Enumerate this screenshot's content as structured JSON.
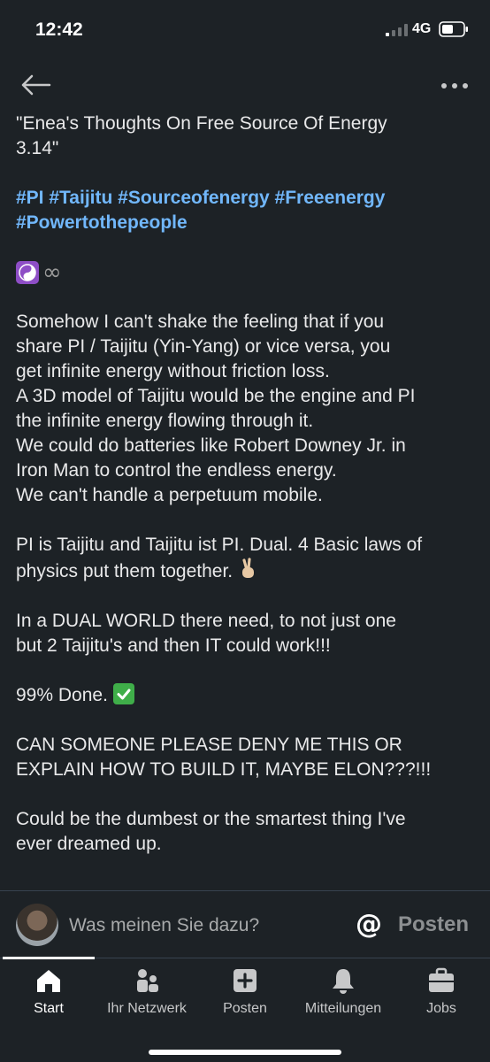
{
  "status_bar": {
    "time": "12:42",
    "network": "4G"
  },
  "nav": {
    "back_icon": "arrow-left-icon",
    "more_icon": "more-horizontal-icon"
  },
  "post": {
    "title_line1": "\"Enea's Thoughts On Free Source Of Energy",
    "title_line2": "3.14\"",
    "hashtags_line1": "#PI #Taijitu #Sourceofenergy #Freeenergy",
    "hashtags_line2": "#Powertothepeople",
    "emoji_icons": [
      "yin-yang-icon",
      "infinity-icon"
    ],
    "para1": [
      "Somehow I can't shake the feeling that if you",
      "share PI / Taijitu (Yin-Yang) or vice versa, you",
      "get infinite energy without friction loss.",
      "A 3D model of Taijitu would be the engine and PI",
      "the infinite energy flowing through it.",
      "We could do batteries like Robert Downey Jr. in",
      "Iron Man to control the endless energy.",
      "We can't handle a perpetuum mobile."
    ],
    "para2_line1": "PI is Taijitu and Taijitu ist PI. Dual. 4 Basic laws of",
    "para2_line2": "physics put them together.",
    "para3_line1": "In a DUAL WORLD there need, to not just one",
    "para3_line2": "but 2 Taijitu's and then IT could work!!!",
    "para4": "99% Done.",
    "para5_line1": "CAN SOMEONE PLEASE DENY ME THIS OR",
    "para5_line2": "EXPLAIN HOW TO BUILD IT, MAYBE ELON???!!!",
    "para6_line1": "Could be the dumbest or the smartest thing I've",
    "para6_line2": "ever dreamed up."
  },
  "comment_bar": {
    "placeholder": "Was meinen Sie dazu?",
    "mention_label": "@",
    "post_label": "Posten"
  },
  "bottom_nav": {
    "items": [
      {
        "label": "Start",
        "icon": "home-icon"
      },
      {
        "label": "Ihr Netzwerk",
        "icon": "network-icon"
      },
      {
        "label": "Posten",
        "icon": "add-post-icon"
      },
      {
        "label": "Mitteilungen",
        "icon": "bell-icon"
      },
      {
        "label": "Jobs",
        "icon": "briefcase-icon"
      }
    ]
  },
  "colors": {
    "background": "#1d2226",
    "text": "#e9e9ea",
    "hashtag": "#71b7fb",
    "muted": "#a8aaab"
  }
}
